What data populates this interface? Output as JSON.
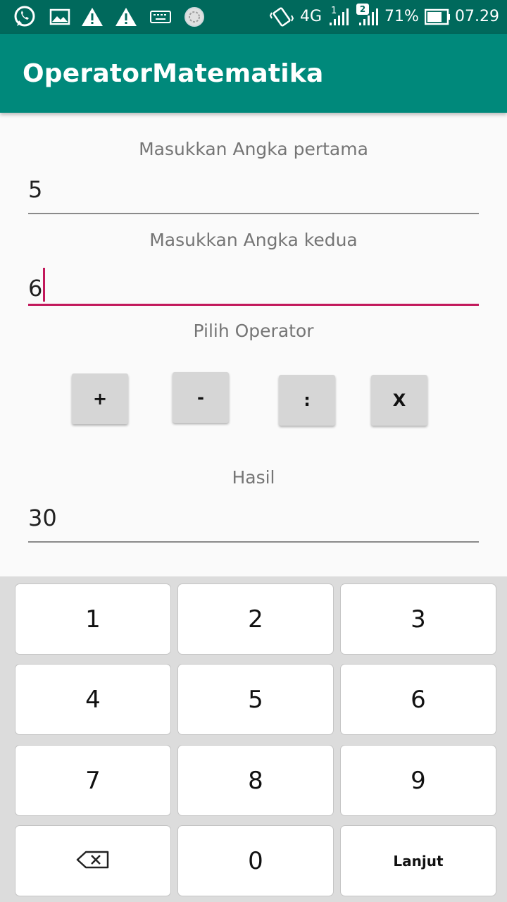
{
  "status_bar": {
    "network": "4G",
    "sim_badge": "2",
    "sim1_label": "1",
    "battery": "71%",
    "time": "07.29",
    "icons": [
      "whatsapp-icon",
      "image-icon",
      "warning-icon",
      "warning-icon",
      "keyboard-icon",
      "sync-icon",
      "vibrate-icon",
      "signal-icon",
      "signal-icon",
      "battery-icon"
    ]
  },
  "app_bar": {
    "title": "OperatorMatematika"
  },
  "form": {
    "first_label": "Masukkan Angka pertama",
    "first_value": "5",
    "second_label": "Masukkan Angka kedua",
    "second_value": "6",
    "operator_label": "Pilih Operator",
    "operators": [
      "+",
      "-",
      ":",
      "X"
    ],
    "result_label": "Hasil",
    "result_value": "30"
  },
  "keyboard": {
    "keys": [
      "1",
      "2",
      "3",
      "4",
      "5",
      "6",
      "7",
      "8",
      "9",
      "",
      "0",
      "Lanjut"
    ],
    "backspace_icon": "backspace-icon"
  },
  "colors": {
    "status_bar": "#00695c",
    "app_bar": "#00897b",
    "accent": "#c2185b",
    "button": "#d6d6d6",
    "keyboard_bg": "#dcdcdc"
  }
}
